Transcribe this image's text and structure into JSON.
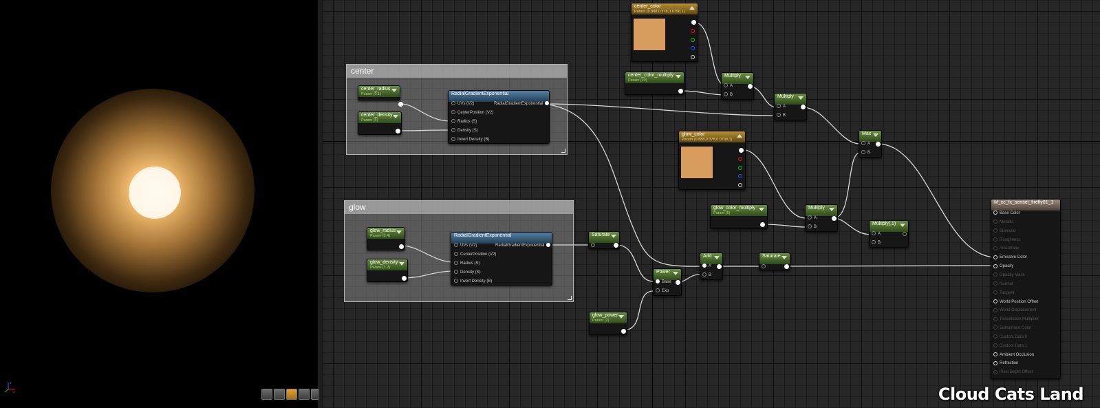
{
  "viewport": {
    "toolbar_icons": [
      "transform-icon",
      "sphere-icon",
      "plane-icon",
      "cube-icon",
      "mesh-icon"
    ],
    "axis_labels": {
      "z": "z",
      "x": "x"
    }
  },
  "comments": {
    "center": "center",
    "glow": "glow"
  },
  "nodes": {
    "center_radius": {
      "title": "center_radius",
      "sub": "Param (0.1)"
    },
    "center_density": {
      "title": "center_density",
      "sub": "Param (5)"
    },
    "rge1": {
      "title": "RadialGradientExponential",
      "inputs": [
        "UVs (V2)",
        "CenterPosition (V2)",
        "Radius (S)",
        "Density (S)",
        "Invert Density (B)"
      ],
      "output": "RadialGradientExponential"
    },
    "glow_radius": {
      "title": "glow_radius",
      "sub": "Param (0.4)"
    },
    "glow_density": {
      "title": "glow_density",
      "sub": "Param (1.2)"
    },
    "rge2": {
      "title": "RadialGradientExponential",
      "inputs": [
        "UVs (V2)",
        "CenterPosition (V2)",
        "Radius (S)",
        "Density (S)",
        "Invert Density (B)"
      ],
      "output": "RadialGradientExponential"
    },
    "center_color": {
      "title": "center_color",
      "sub": "Param (0.888,0.378,0.0798,1)",
      "color": "#D89C5E"
    },
    "center_color_multiply": {
      "title": "center_color_multiply",
      "sub": "Param (10)"
    },
    "multiply1": {
      "title": "Multiply",
      "a": "A",
      "b": "B"
    },
    "multiply2": {
      "title": "Multiply",
      "a": "A",
      "b": "B"
    },
    "glow_color": {
      "title": "glow_color",
      "sub": "Param (0.888,0.378,0.0798,1)",
      "color": "#D89C5E"
    },
    "max": {
      "title": "Max",
      "a": "A",
      "b": "B"
    },
    "glow_color_multiply": {
      "title": "glow_color_multiply",
      "sub": "Param (5)"
    },
    "multiply3": {
      "title": "Multiply",
      "a": "A",
      "b": "B"
    },
    "multiply4": {
      "title": "Multiply(,1)",
      "a": "A",
      "b": "B"
    },
    "saturate1": {
      "title": "Saturate"
    },
    "power": {
      "title": "Power",
      "a": "Base",
      "b": "Exp"
    },
    "glow_power": {
      "title": "glow_power",
      "sub": "Param (2)"
    },
    "add": {
      "title": "Add",
      "a": "A",
      "b": "B"
    },
    "saturate2": {
      "title": "Saturate"
    }
  },
  "material": {
    "title": "M_cc_fx_sensei_firefly01_1",
    "pins": [
      {
        "label": "Base Color",
        "active": true
      },
      {
        "label": "Metallic",
        "active": false
      },
      {
        "label": "Specular",
        "active": false
      },
      {
        "label": "Roughness",
        "active": false
      },
      {
        "label": "Anisotropy",
        "active": false
      },
      {
        "label": "Emissive Color",
        "active": true
      },
      {
        "label": "Opacity",
        "active": true
      },
      {
        "label": "Opacity Mask",
        "active": false
      },
      {
        "label": "Normal",
        "active": false
      },
      {
        "label": "Tangent",
        "active": false
      },
      {
        "label": "World Position Offset",
        "active": true
      },
      {
        "label": "World Displacement",
        "active": false
      },
      {
        "label": "Tessellation Multiplier",
        "active": false
      },
      {
        "label": "Subsurface Color",
        "active": false
      },
      {
        "label": "Custom Data 0",
        "active": false
      },
      {
        "label": "Custom Data 1",
        "active": false
      },
      {
        "label": "Ambient Occlusion",
        "active": true
      },
      {
        "label": "Refraction",
        "active": true
      },
      {
        "label": "Pixel Depth Offset",
        "active": false
      }
    ]
  },
  "watermark": "Cloud Cats Land"
}
